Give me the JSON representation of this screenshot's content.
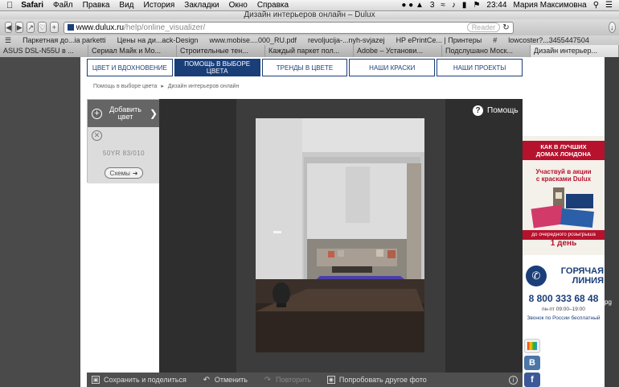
{
  "menubar": {
    "app": "Safari",
    "items": [
      "Файл",
      "Правка",
      "Вид",
      "История",
      "Закладки",
      "Окно",
      "Справка"
    ],
    "battery": "3",
    "time": "23:44",
    "user": "Мария Максимовна"
  },
  "window": {
    "title": "Дизайн интерьеров онлайн – Dulux"
  },
  "toolbar": {
    "url_host": "www.dulux.ru",
    "url_path": "/help/online_visualizer/",
    "reader": "Reader"
  },
  "bookmarks": [
    "Паркетная до...ia parketti",
    "Цены на ди...ack-Design",
    "www.mobise....000_RU.pdf",
    "revoljucija-...nyh-svjazej",
    "HP ePrintCe... | Принтеры",
    "#",
    "lowcoster?...3455447504"
  ],
  "tabs": [
    {
      "label": "ASUS DSL-N55U в ...",
      "active": false
    },
    {
      "label": "Сериал Майк и Мо...",
      "active": false
    },
    {
      "label": "Строительные тен...",
      "active": false
    },
    {
      "label": "Каждый паркет пол...",
      "active": false
    },
    {
      "label": "Adobe – Установи...",
      "active": false
    },
    {
      "label": "Подслушано Моск...",
      "active": false
    },
    {
      "label": "Дизайн интерьер...",
      "active": true
    }
  ],
  "nav": [
    {
      "label": "ЦВЕТ И ВДОХНОВЕНИЕ",
      "active": false
    },
    {
      "label": "ПОМОЩЬ В ВЫБОРЕ ЦВЕТА",
      "active": true
    },
    {
      "label": "ТРЕНДЫ В ЦВЕТЕ",
      "active": false
    },
    {
      "label": "НАШИ КРАСКИ",
      "active": false
    },
    {
      "label": "НАШИ ПРОЕКТЫ",
      "active": false
    }
  ],
  "breadcrumb": {
    "parent": "Помощь в выборе цвета",
    "current": "Дизайн интерьеров онлайн"
  },
  "side": {
    "add_line1": "Добавить",
    "add_line2": "цвет",
    "color_code": "50YR 83/010",
    "schemes": "Схемы"
  },
  "viewer": {
    "help": "Помощь"
  },
  "bottom": {
    "save": "Сохранить и поделиться",
    "undo": "Отменить",
    "redo": "Повторить",
    "other_photo": "Попробовать другое фото"
  },
  "promo": {
    "line1": "КАК В ЛУЧШИХ",
    "line2": "ДОМАХ ЛОНДОНА",
    "line3": "Участвуй в акции",
    "line4": "с красками Dulux",
    "line5": "до очередного розыгрыша",
    "line6": "1 день"
  },
  "hotline": {
    "line1": "ГОРЯЧАЯ",
    "line2": "ЛИНИЯ",
    "number": "8 800 333 68 48",
    "hours": "пн-пт 09:00–19:00",
    "free": "Звонок по России бесплатный"
  },
  "social": {
    "vk": "В",
    "fb": "f"
  },
  "edge_text": "pg",
  "colors": {
    "brand_blue": "#1a3e78",
    "promo_red": "#b6122e"
  }
}
